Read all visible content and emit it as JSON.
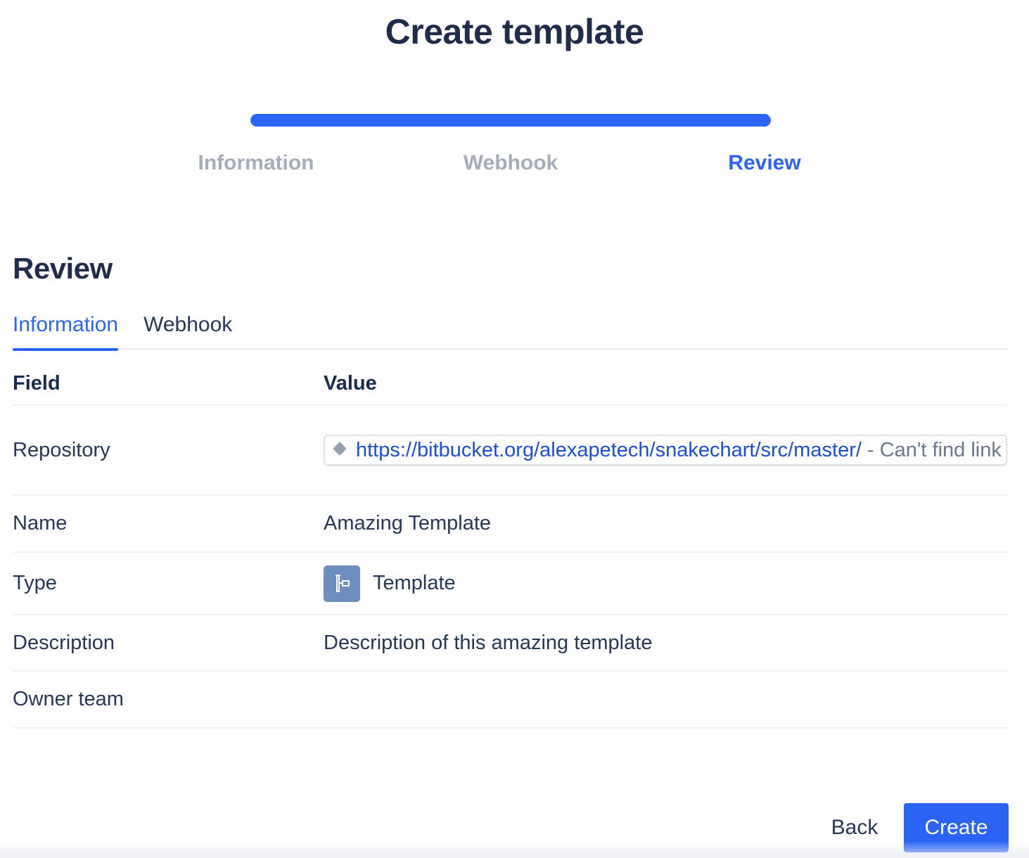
{
  "header": {
    "title": "Create template"
  },
  "progress": {
    "value_percent": 100,
    "color": "#2b64f5"
  },
  "steps": [
    {
      "label": "Information",
      "state": "done"
    },
    {
      "label": "Webhook",
      "state": "done"
    },
    {
      "label": "Review",
      "state": "active"
    }
  ],
  "review": {
    "title": "Review",
    "tabs": [
      {
        "label": "Information",
        "active": true
      },
      {
        "label": "Webhook",
        "active": false
      }
    ],
    "table": {
      "columns": [
        "Field",
        "Value"
      ],
      "rows": {
        "repository": {
          "field": "Repository",
          "link_url": "https://bitbucket.org/alexapetech/snakechart/src/master/",
          "link_error": " - Can't find link",
          "icon": "link-diamond-icon"
        },
        "name": {
          "field": "Name",
          "value": "Amazing Template"
        },
        "type": {
          "field": "Type",
          "value": "Template",
          "icon": "template-icon"
        },
        "description": {
          "field": "Description",
          "value": "Description of this amazing template"
        },
        "owner_team": {
          "field": "Owner team",
          "value": ""
        }
      }
    }
  },
  "actions": {
    "back_label": "Back",
    "create_label": "Create"
  },
  "colors": {
    "accent": "#2b64f5",
    "text_primary": "#172b4d",
    "step_inactive": "#a5adba",
    "type_icon_bg": "#6c8fbf"
  }
}
